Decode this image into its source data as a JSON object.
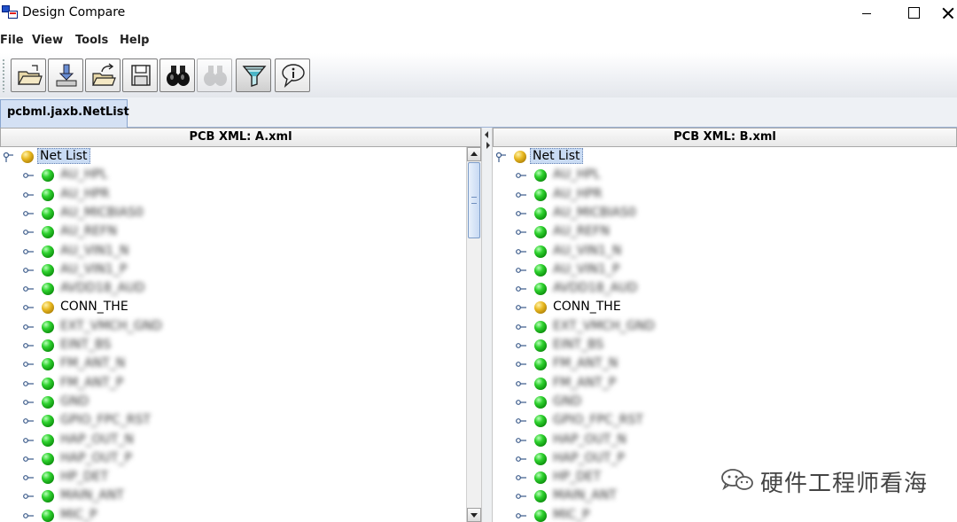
{
  "window": {
    "title": "Design Compare"
  },
  "menu": [
    "File",
    "View",
    "Tools",
    "Help"
  ],
  "toolbar": {
    "buttons": [
      {
        "icon": "open-folder-icon",
        "enabled": true
      },
      {
        "icon": "import-icon",
        "enabled": true
      },
      {
        "icon": "export-icon",
        "enabled": true
      },
      {
        "icon": "save-icon",
        "enabled": true
      },
      {
        "icon": "binoculars-icon",
        "enabled": true
      },
      {
        "icon": "binoculars-disabled-icon",
        "enabled": false
      },
      {
        "icon": "filter-funnel-icon",
        "enabled": true
      },
      {
        "icon": "info-balloon-icon",
        "enabled": true
      }
    ]
  },
  "tabs": [
    {
      "label": "pcbml.jaxb.NetList",
      "active": true
    }
  ],
  "left_panel": {
    "header": "PCB XML: A.xml",
    "root": "Net List",
    "nodes": [
      {
        "label": "AU_HPL",
        "color": "green",
        "obscured": true
      },
      {
        "label": "AU_HPR",
        "color": "green",
        "obscured": true
      },
      {
        "label": "AU_MICBIAS0",
        "color": "green",
        "obscured": true
      },
      {
        "label": "AU_REFN",
        "color": "green",
        "obscured": true
      },
      {
        "label": "AU_VIN1_N",
        "color": "green",
        "obscured": true
      },
      {
        "label": "AU_VIN1_P",
        "color": "green",
        "obscured": true
      },
      {
        "label": "AVDD18_AUD",
        "color": "green",
        "obscured": true
      },
      {
        "label": "CONN_THE",
        "color": "gold",
        "obscured": false
      },
      {
        "label": "EXT_VMCH_GND",
        "color": "green",
        "obscured": true
      },
      {
        "label": "EINT_BS",
        "color": "green",
        "obscured": true
      },
      {
        "label": "FM_ANT_N",
        "color": "green",
        "obscured": true
      },
      {
        "label": "FM_ANT_P",
        "color": "green",
        "obscured": true
      },
      {
        "label": "GND",
        "color": "green",
        "obscured": true
      },
      {
        "label": "GPIO_FPC_RST",
        "color": "green",
        "obscured": true
      },
      {
        "label": "HAP_OUT_N",
        "color": "green",
        "obscured": true
      },
      {
        "label": "HAP_OUT_P",
        "color": "green",
        "obscured": true
      },
      {
        "label": "HP_DET",
        "color": "green",
        "obscured": true
      },
      {
        "label": "MAIN_ANT",
        "color": "green",
        "obscured": true
      },
      {
        "label": "MIC_P",
        "color": "green",
        "obscured": true
      }
    ]
  },
  "right_panel": {
    "header": "PCB XML: B.xml",
    "root": "Net List",
    "nodes": [
      {
        "label": "AU_HPL",
        "color": "green",
        "obscured": true
      },
      {
        "label": "AU_HPR",
        "color": "green",
        "obscured": true
      },
      {
        "label": "AU_MICBIAS0",
        "color": "green",
        "obscured": true
      },
      {
        "label": "AU_REFN",
        "color": "green",
        "obscured": true
      },
      {
        "label": "AU_VIN1_N",
        "color": "green",
        "obscured": true
      },
      {
        "label": "AU_VIN1_P",
        "color": "green",
        "obscured": true
      },
      {
        "label": "AVDD18_AUD",
        "color": "green",
        "obscured": true
      },
      {
        "label": "CONN_THE",
        "color": "gold",
        "obscured": false
      },
      {
        "label": "EXT_VMCH_GND",
        "color": "green",
        "obscured": true
      },
      {
        "label": "EINT_BS",
        "color": "green",
        "obscured": true
      },
      {
        "label": "FM_ANT_N",
        "color": "green",
        "obscured": true
      },
      {
        "label": "FM_ANT_P",
        "color": "green",
        "obscured": true
      },
      {
        "label": "GND",
        "color": "green",
        "obscured": true
      },
      {
        "label": "GPIO_FPC_RST",
        "color": "green",
        "obscured": true
      },
      {
        "label": "HAP_OUT_N",
        "color": "green",
        "obscured": true
      },
      {
        "label": "HAP_OUT_P",
        "color": "green",
        "obscured": true
      },
      {
        "label": "HP_DET",
        "color": "green",
        "obscured": true
      },
      {
        "label": "MAIN_ANT",
        "color": "green",
        "obscured": true
      },
      {
        "label": "MIC_P",
        "color": "green",
        "obscured": true
      }
    ]
  },
  "watermark": {
    "text": "硬件工程师看海",
    "icon": "wechat-icon"
  },
  "colors": {
    "tab_bg": "#d4e1f4",
    "root_selection": "#c9dbf3",
    "node_green": "#1fb81f",
    "node_gold": "#d4a010"
  }
}
